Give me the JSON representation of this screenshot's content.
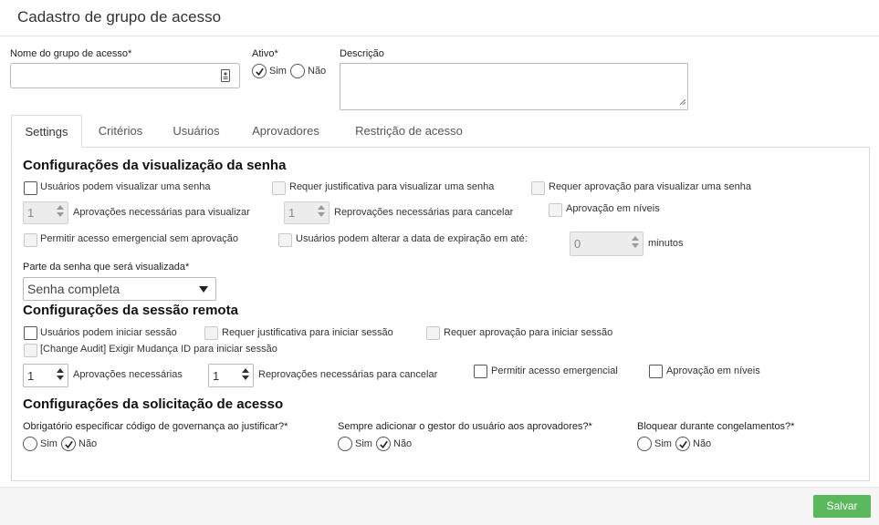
{
  "page": {
    "title": "Cadastro de grupo de acesso"
  },
  "form": {
    "name_label": "Nome do grupo de acesso*",
    "name_value": "",
    "active_label": "Ativo*",
    "active_yes": "Sim",
    "active_no": "Não",
    "active_selected": "Sim",
    "description_label": "Descrição",
    "description_value": ""
  },
  "tabs": [
    {
      "label": "Settings",
      "active": true
    },
    {
      "label": "Critérios",
      "active": false
    },
    {
      "label": "Usuários",
      "active": false
    },
    {
      "label": "Aprovadores",
      "active": false
    },
    {
      "label": "Restrição de acesso",
      "active": false
    }
  ],
  "password_view": {
    "title": "Configurações da visualização da senha",
    "users_can_view": "Usuários podem visualizar uma senha",
    "require_justification": "Requer justificativa para visualizar uma senha",
    "require_approval": "Requer aprovação para visualizar uma senha",
    "approvals_value": "1",
    "approvals_label": "Aprovações necessárias para visualizar",
    "rejections_value": "1",
    "rejections_label": "Reprovações necessárias para cancelar",
    "approval_levels": "Aprovação em níveis",
    "emergency_access": "Permitir acesso emergencial sem aprovação",
    "change_expiration": "Usuários podem alterar a data de expiração em até:",
    "minutes_value": "0",
    "minutes_label": "minutos",
    "part_label": "Parte da senha que será visualizada*",
    "part_value": "Senha completa"
  },
  "remote_session": {
    "title": "Configurações da sessão remota",
    "users_can_start": "Usuários podem iniciar sessão",
    "require_justification": "Requer justificativa para iniciar sessão",
    "require_approval": "Requer aprovação para iniciar sessão",
    "change_audit": "[Change Audit] Exigir Mudança ID para iniciar sessão",
    "approvals_value": "1",
    "approvals_label": "Aprovações necessárias",
    "rejections_value": "1",
    "rejections_label": "Reprovações necessárias para cancelar",
    "emergency_access": "Permitir acesso emergencial",
    "approval_levels": "Aprovação em níveis"
  },
  "access_request": {
    "title": "Configurações da solicitação de acesso",
    "q1": {
      "label": "Obrigatório especificar código de governança ao justificar?*",
      "yes": "Sim",
      "no": "Não",
      "selected": "Não"
    },
    "q2": {
      "label": "Sempre adicionar o gestor do usuário aos aprovadores?*",
      "yes": "Sim",
      "no": "Não",
      "selected": "Não"
    },
    "q3": {
      "label": "Bloquear durante congelamentos?*",
      "yes": "Sim",
      "no": "Não",
      "selected": "Não"
    }
  },
  "footer": {
    "save_label": "Salvar"
  },
  "colors": {
    "save_button": "#5cb85c",
    "border": "#d9d9d9"
  }
}
